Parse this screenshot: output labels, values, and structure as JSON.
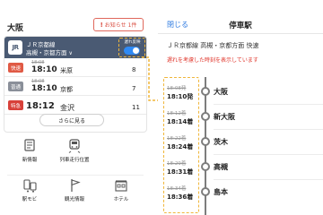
{
  "left": {
    "city": "大阪",
    "notice": {
      "mark": "!",
      "label": "お知らせ 1件"
    },
    "line_card": {
      "logo": "JR",
      "line_name": "ＪＲ京都線",
      "direction": "高槻・京都方面",
      "direction_chevron": "∨",
      "delay_toggle_label": "遅れ反映",
      "delay_toggle_on": true
    },
    "departures": [
      {
        "type": "快速",
        "type_color": "#e05a45",
        "scheduled": "18:08",
        "time": "18:10",
        "dest": "米原",
        "track": "8"
      },
      {
        "type": "普通",
        "type_color": "#8a8f99",
        "scheduled": "18:08",
        "time": "18:10",
        "dest": "京都",
        "track": "7"
      },
      {
        "type": "特急",
        "type_color": "#d8413a",
        "scheduled": "",
        "time": "18:12",
        "dest": "金沢",
        "track": "11"
      }
    ],
    "more_button": "さらに見る",
    "menu": [
      {
        "icon": "newspaper-icon",
        "label": "新情報"
      },
      {
        "icon": "train-position-icon",
        "label": "列車走行位置"
      },
      {
        "icon": "station-mobile-icon",
        "label": "駅モビ"
      },
      {
        "icon": "flag-icon",
        "label": "観光情報"
      },
      {
        "icon": "hotel-icon",
        "label": "ホテル"
      }
    ]
  },
  "right": {
    "close": "閉じる",
    "title": "停車駅",
    "line": "ＪＲ京都線 高槻・京都方面 快速",
    "note": "遅れを考慮した時刻を表示しています",
    "stops": [
      {
        "scheduled": "18:08発",
        "actual": "18:10発",
        "station": "大阪"
      },
      {
        "scheduled": "18:12着",
        "actual": "18:14着",
        "station": "新大阪"
      },
      {
        "scheduled": "18:22着",
        "actual": "18:24着",
        "station": "茨木"
      },
      {
        "scheduled": "18:29着",
        "actual": "18:31着",
        "station": "高槻"
      },
      {
        "scheduled": "18:34着",
        "actual": "18:36着",
        "station": "島本"
      }
    ]
  },
  "colors": {
    "line_band": "#4a5a73",
    "accent_blue": "#2f8af5",
    "highlight_dashed": "#f0b63a",
    "delay_red": "#e0352b"
  }
}
